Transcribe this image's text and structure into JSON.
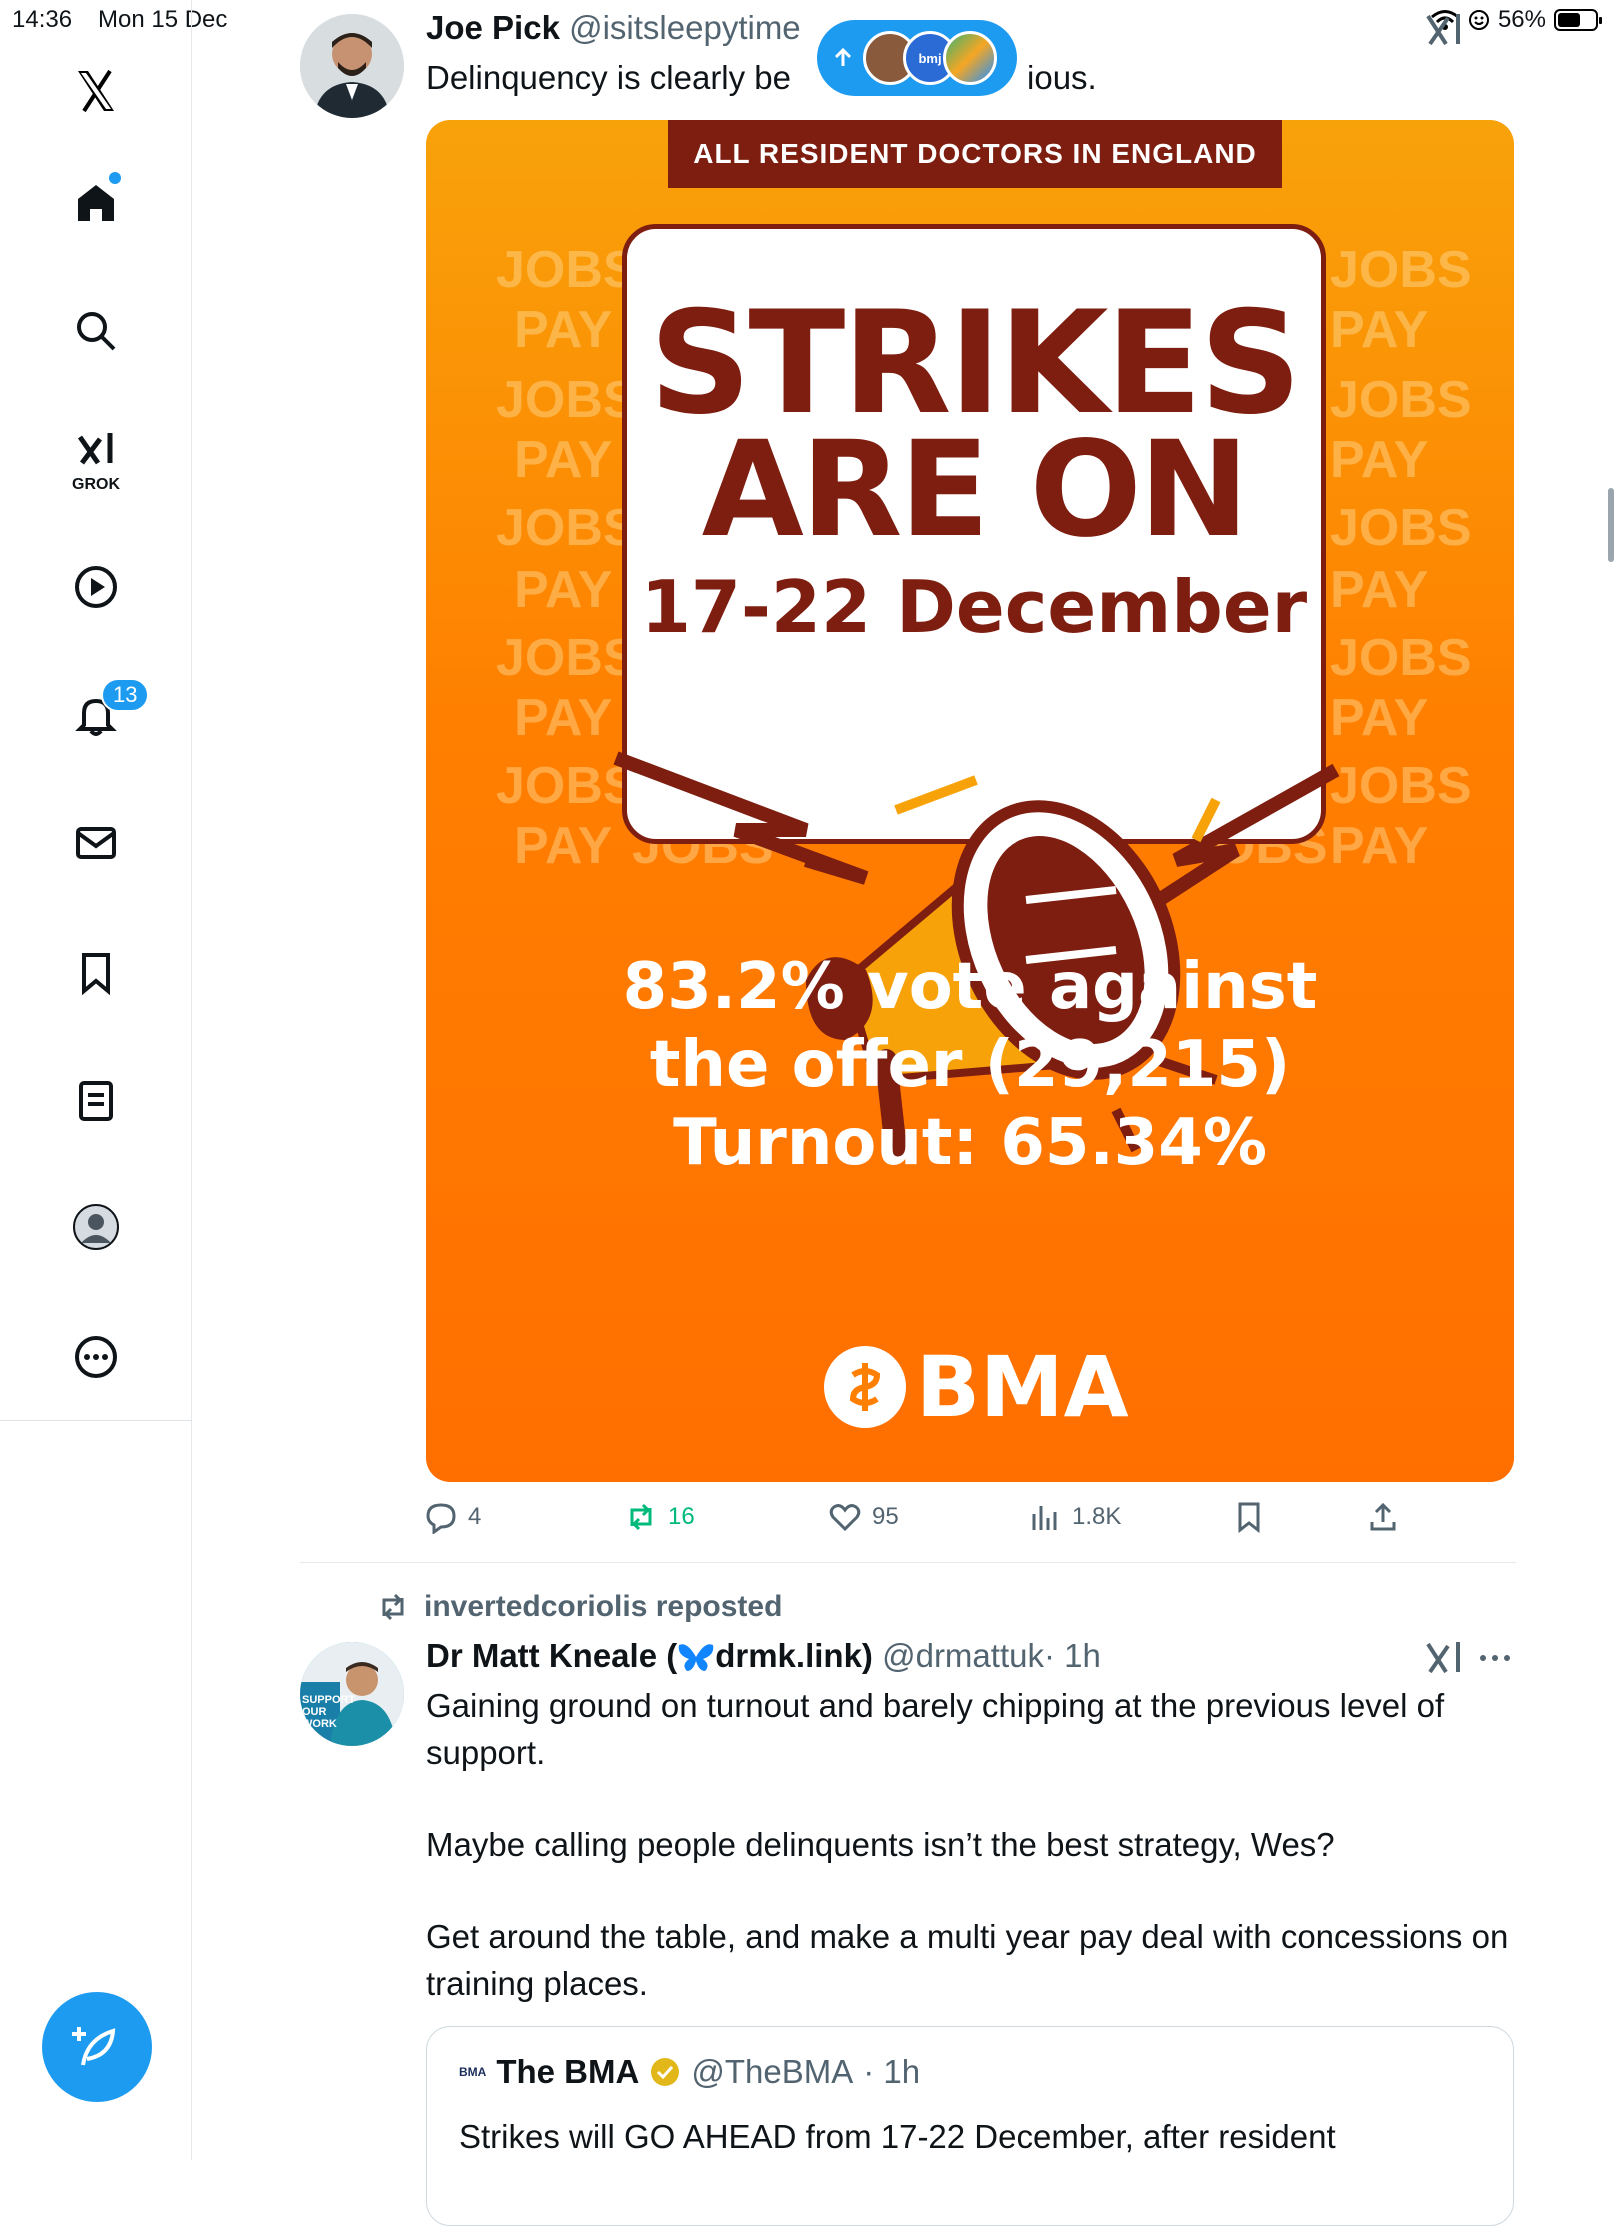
{
  "status_bar": {
    "time": "14:36",
    "date": "Mon 15 Dec",
    "battery": "56%"
  },
  "sidebar": {
    "grok_label": "GROK",
    "notifications_count": "13"
  },
  "tweet1": {
    "name": "Joe Pick",
    "handle": "@isitsleepytime",
    "text_start": "Delinquency is clearly be",
    "text_end": "ious.",
    "poster": {
      "banner": "ALL RESIDENT DOCTORS IN ENGLAND",
      "bg_word_jobs": "JOBS",
      "bg_word_pay": "PAY",
      "headline1": "STRIKES",
      "headline2": "ARE ON",
      "dates": "17-22 December",
      "vote_line1": "83.2% vote against",
      "vote_line2": "the offer (29,215)",
      "vote_line3": "Turnout: 65.34%",
      "brand": "BMA"
    },
    "actions": {
      "replies": "4",
      "reposts": "16",
      "likes": "95",
      "views": "1.8K"
    }
  },
  "popup": {
    "label": "bmj"
  },
  "tweet2": {
    "repost_by": "invertedcoriolis reposted",
    "name_prefix": "Dr Matt Kneale (",
    "name_suffix": "drmk.link)",
    "handle": "@drmattuk",
    "time": "· 1h",
    "para1": "Gaining ground on turnout and barely chipping at the previous level of support.",
    "para2": "Maybe calling people delinquents isn’t the best strategy, Wes?",
    "para3": "Get around the table, and make a multi year pay deal with concessions on training places.",
    "avatar_text": "SUPPORT OUR WORK"
  },
  "quote": {
    "logo": "BMA",
    "name": "The BMA",
    "handle": "@TheBMA",
    "time": "· 1h",
    "text": "Strikes will GO AHEAD from 17-22 December, after resident"
  },
  "colors": {
    "accent": "#1d9bf0",
    "maroon": "#7e1e10",
    "orange": "#ff7f00",
    "repost_green": "#00ba7c"
  }
}
